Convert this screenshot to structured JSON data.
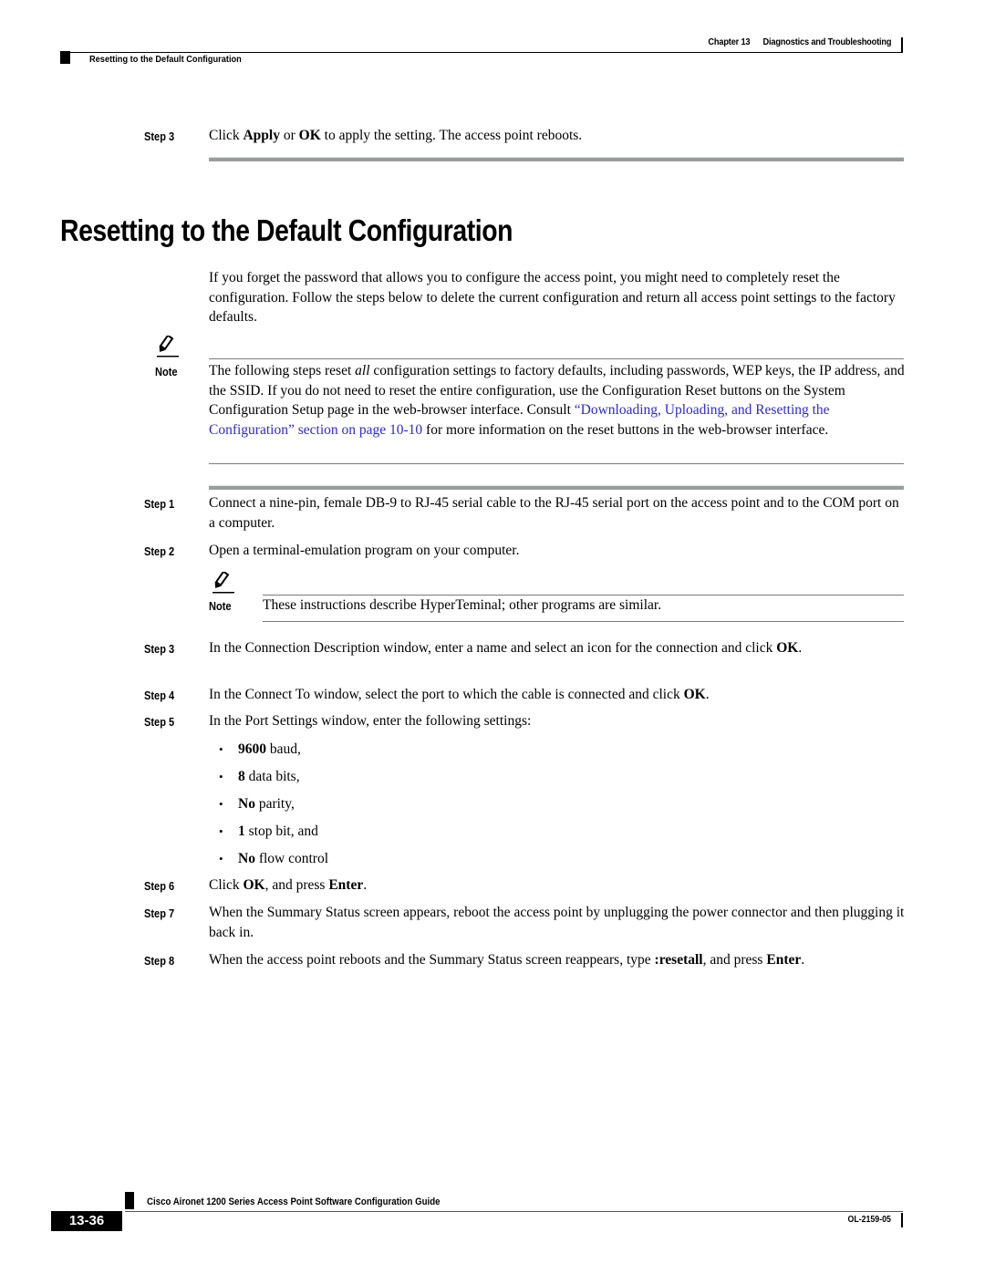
{
  "header": {
    "chapter": "Chapter 13",
    "chapter_title": "Diagnostics and Troubleshooting",
    "section": "Resetting to the Default Configuration"
  },
  "previous_step": {
    "label": "Step 3",
    "text_parts": [
      "Click ",
      "Apply",
      " or ",
      "OK",
      " to apply the setting. The access point reboots."
    ]
  },
  "section_title": "Resetting to the Default Configuration",
  "intro": "If you forget the password that allows you to configure the access point, you might need to completely reset the configuration. Follow the steps below to delete the current configuration and return all access point settings to the factory defaults.",
  "note1": {
    "icon": "pencil-note-icon",
    "label": "Note",
    "text_before_italic": "The following steps reset ",
    "italic": "all",
    "text_after_italic": " configuration settings to factory defaults, including passwords, WEP keys, the IP address, and the SSID. If you do not need to reset the entire configuration, use the Configuration Reset buttons on the System Configuration Setup page in the web-browser interface. Consult ",
    "link": "“Downloading, Uploading, and Resetting the Configuration” section on page 10-10",
    "text_end": " for more information on the reset buttons in the web-browser interface."
  },
  "steps": [
    {
      "label": "Step 1",
      "text": "Connect a nine-pin, female DB-9 to RJ-45 serial cable to the RJ-45 serial port on the access point and to the COM port on a computer."
    },
    {
      "label": "Step 2",
      "text": "Open a terminal-emulation program on your computer."
    },
    {
      "label": "Step 3",
      "text": "In the Connection Description window, enter a name and select an icon for the connection and click ",
      "bold": "OK",
      "end": "."
    },
    {
      "label": "Step 4",
      "text": "In the Connect To window, select the port to which the cable is connected and click ",
      "bold": "OK",
      "end": "."
    },
    {
      "label": "Step 5",
      "text": "In the Port Settings window, enter the following settings:"
    },
    {
      "label": "Step 6",
      "parts": [
        "Click ",
        "OK",
        ", and press ",
        "Enter",
        "."
      ]
    },
    {
      "label": "Step 7",
      "text": "When the Summary Status screen appears, reboot the access point by unplugging the power connector and then plugging it back in."
    },
    {
      "label": "Step 8",
      "parts": [
        "When the access point reboots and the Summary Status screen reappears, type ",
        ":resetall",
        ", and press ",
        "Enter",
        "."
      ]
    }
  ],
  "note2": {
    "icon": "pencil-note-icon",
    "label": "Note",
    "text": "These instructions describe HyperTeminal; other programs are similar."
  },
  "port_settings": [
    {
      "bullet": "•",
      "bold": "9600",
      "rest": " baud,"
    },
    {
      "bullet": "•",
      "bold": "8",
      "rest": " data bits,"
    },
    {
      "bullet": "•",
      "bold": "No",
      "rest": " parity,"
    },
    {
      "bullet": "•",
      "bold": "1",
      "rest": " stop bit, and"
    },
    {
      "bullet": "•",
      "bold": "No",
      "rest": " flow control"
    }
  ],
  "footer": {
    "guide_title": "Cisco Aironet 1200 Series Access Point Software Configuration Guide",
    "page_number": "13-36",
    "doc_number": "OL-2159-05"
  },
  "colors": {
    "link": "#2a2ad8",
    "rule": "#9a9c9c"
  }
}
